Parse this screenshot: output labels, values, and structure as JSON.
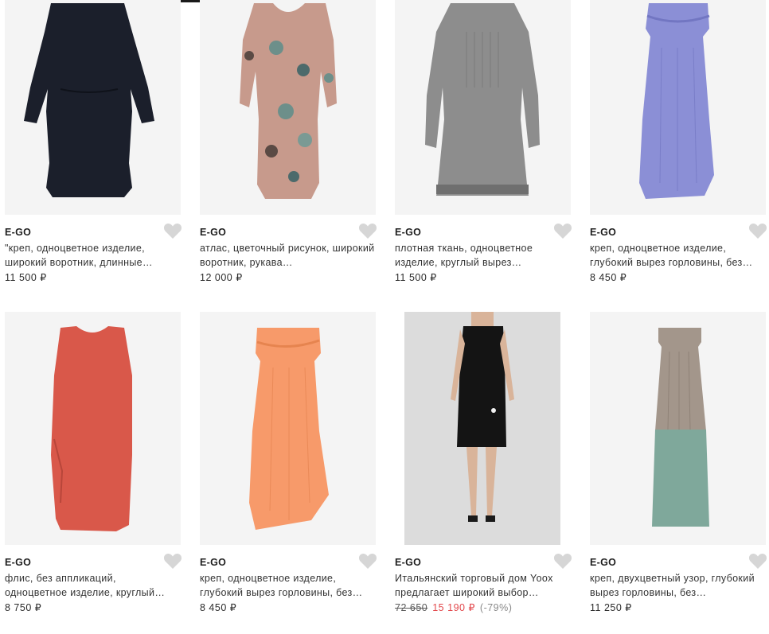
{
  "products": [
    {
      "brand": "E-GO",
      "desc": "\"креп, одноцветное изделие, широкий воротник, длинные…",
      "price": "11 500 ₽",
      "image": "black-long-sleeve-dress"
    },
    {
      "brand": "E-GO",
      "desc": "атлас, цветочный рисунок, широкий воротник, рукава…",
      "price": "12 000 ₽",
      "image": "pink-floral-satin-dress"
    },
    {
      "brand": "E-GO",
      "desc": "плотная ткань, одноцветное изделие, круглый вырез…",
      "price": "11 500 ₽",
      "image": "grey-pleated-dress"
    },
    {
      "brand": "E-GO",
      "desc": "креп, одноцветное изделие, глубокий вырез горловины, без…",
      "price": "8 450 ₽",
      "image": "lilac-strapless-dress"
    },
    {
      "brand": "E-GO",
      "desc": "флис, без аппликаций, одноцветное изделие, круглый…",
      "price": "8 750 ₽",
      "image": "coral-sleeveless-dress"
    },
    {
      "brand": "E-GO",
      "desc": "креп, одноцветное изделие, глубокий вырез горловины, без…",
      "price": "8 450 ₽",
      "image": "orange-strapless-dress"
    },
    {
      "brand": "E-GO",
      "desc": "Итальянский торговый дом Yoox предлагает широкий выбор…",
      "old_price": "72 650",
      "sale_price": "15 190 ₽",
      "discount": "(-79%)",
      "image": "black-dress-on-model"
    },
    {
      "brand": "E-GO",
      "desc": "креп, двухцветный узор, глубокий вырез горловины, без…",
      "price": "11 250 ₽",
      "image": "two-tone-maxi-dress"
    }
  ],
  "icons": {
    "favorite": "heart-icon"
  },
  "colors": {
    "sale": "#e2474b",
    "photo_bg": "#f4f4f4",
    "heart": "#d6d6d6"
  }
}
